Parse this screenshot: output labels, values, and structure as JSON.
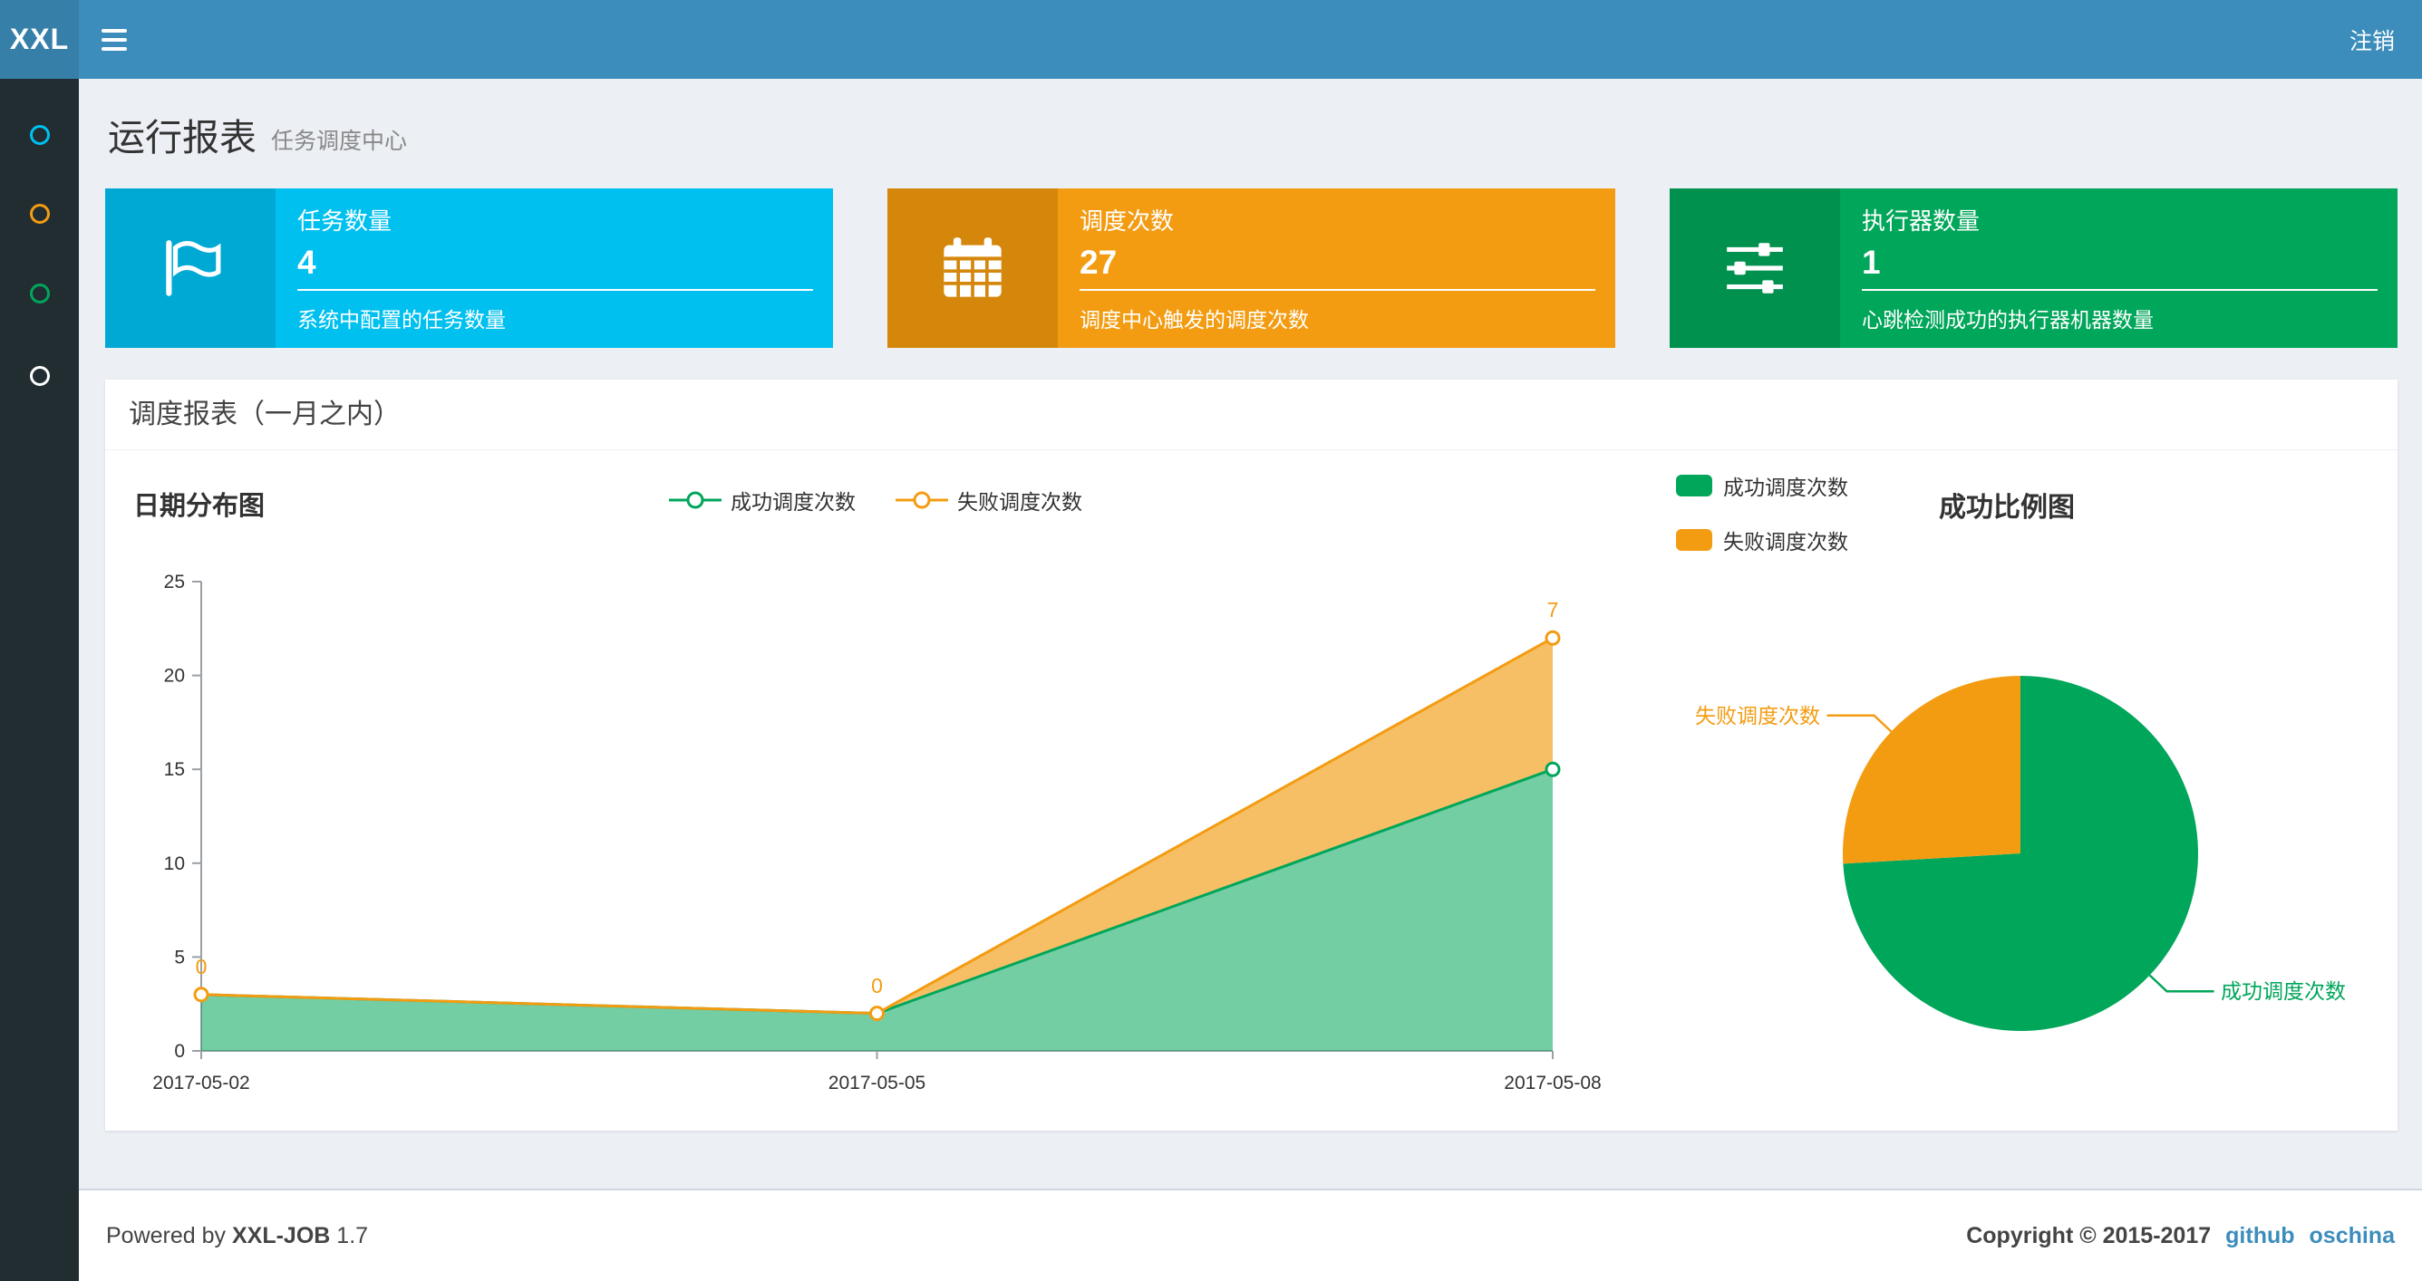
{
  "navbar": {
    "logo": "XXL",
    "logout_label": "注销"
  },
  "sidebar": {
    "items": [
      {
        "icon": "circle-icon",
        "color": "#00c0ef"
      },
      {
        "icon": "circle-icon",
        "color": "#f39c12"
      },
      {
        "icon": "circle-icon",
        "color": "#00a65a"
      },
      {
        "icon": "circle-icon",
        "color": "#ffffff"
      }
    ]
  },
  "page_header": {
    "title": "运行报表",
    "subtitle": "任务调度中心"
  },
  "info_boxes": [
    {
      "title": "任务数量",
      "value": "4",
      "desc": "系统中配置的任务数量",
      "color": "#00c0ef",
      "icon": "flag-icon"
    },
    {
      "title": "调度次数",
      "value": "27",
      "desc": "调度中心触发的调度次数",
      "color": "#f39c12",
      "icon": "calendar-icon"
    },
    {
      "title": "执行器数量",
      "value": "1",
      "desc": "心跳检测成功的执行器机器数量",
      "color": "#00a65a",
      "icon": "sliders-icon"
    }
  ],
  "panel": {
    "title": "调度报表（一月之内）"
  },
  "chart_data": [
    {
      "type": "area",
      "title": "日期分布图",
      "x": [
        "2017-05-02",
        "2017-05-05",
        "2017-05-08"
      ],
      "series": [
        {
          "name": "成功调度次数",
          "values": [
            3,
            2,
            15
          ],
          "color": "#00a65a"
        },
        {
          "name": "失败调度次数",
          "values": [
            0,
            0,
            7
          ],
          "color": "#f39c12",
          "point_labels": [
            "0",
            "0",
            "7"
          ]
        }
      ],
      "stacked": true,
      "ylim": [
        0,
        25
      ],
      "y_ticks": [
        0,
        5,
        10,
        15,
        20,
        25
      ],
      "legend_position": "top",
      "grid": false
    },
    {
      "type": "pie",
      "title": "成功比例图",
      "labels": [
        "成功调度次数",
        "失败调度次数"
      ],
      "values": [
        20,
        7
      ],
      "colors": [
        "#00a65a",
        "#f39c12"
      ],
      "legend_position": "top-left"
    }
  ],
  "footer": {
    "powered_by": "Powered by",
    "brand": "XXL-JOB",
    "version": "1.7",
    "copyright": "Copyright © 2015-2017",
    "links": [
      "github",
      "oschina"
    ]
  }
}
